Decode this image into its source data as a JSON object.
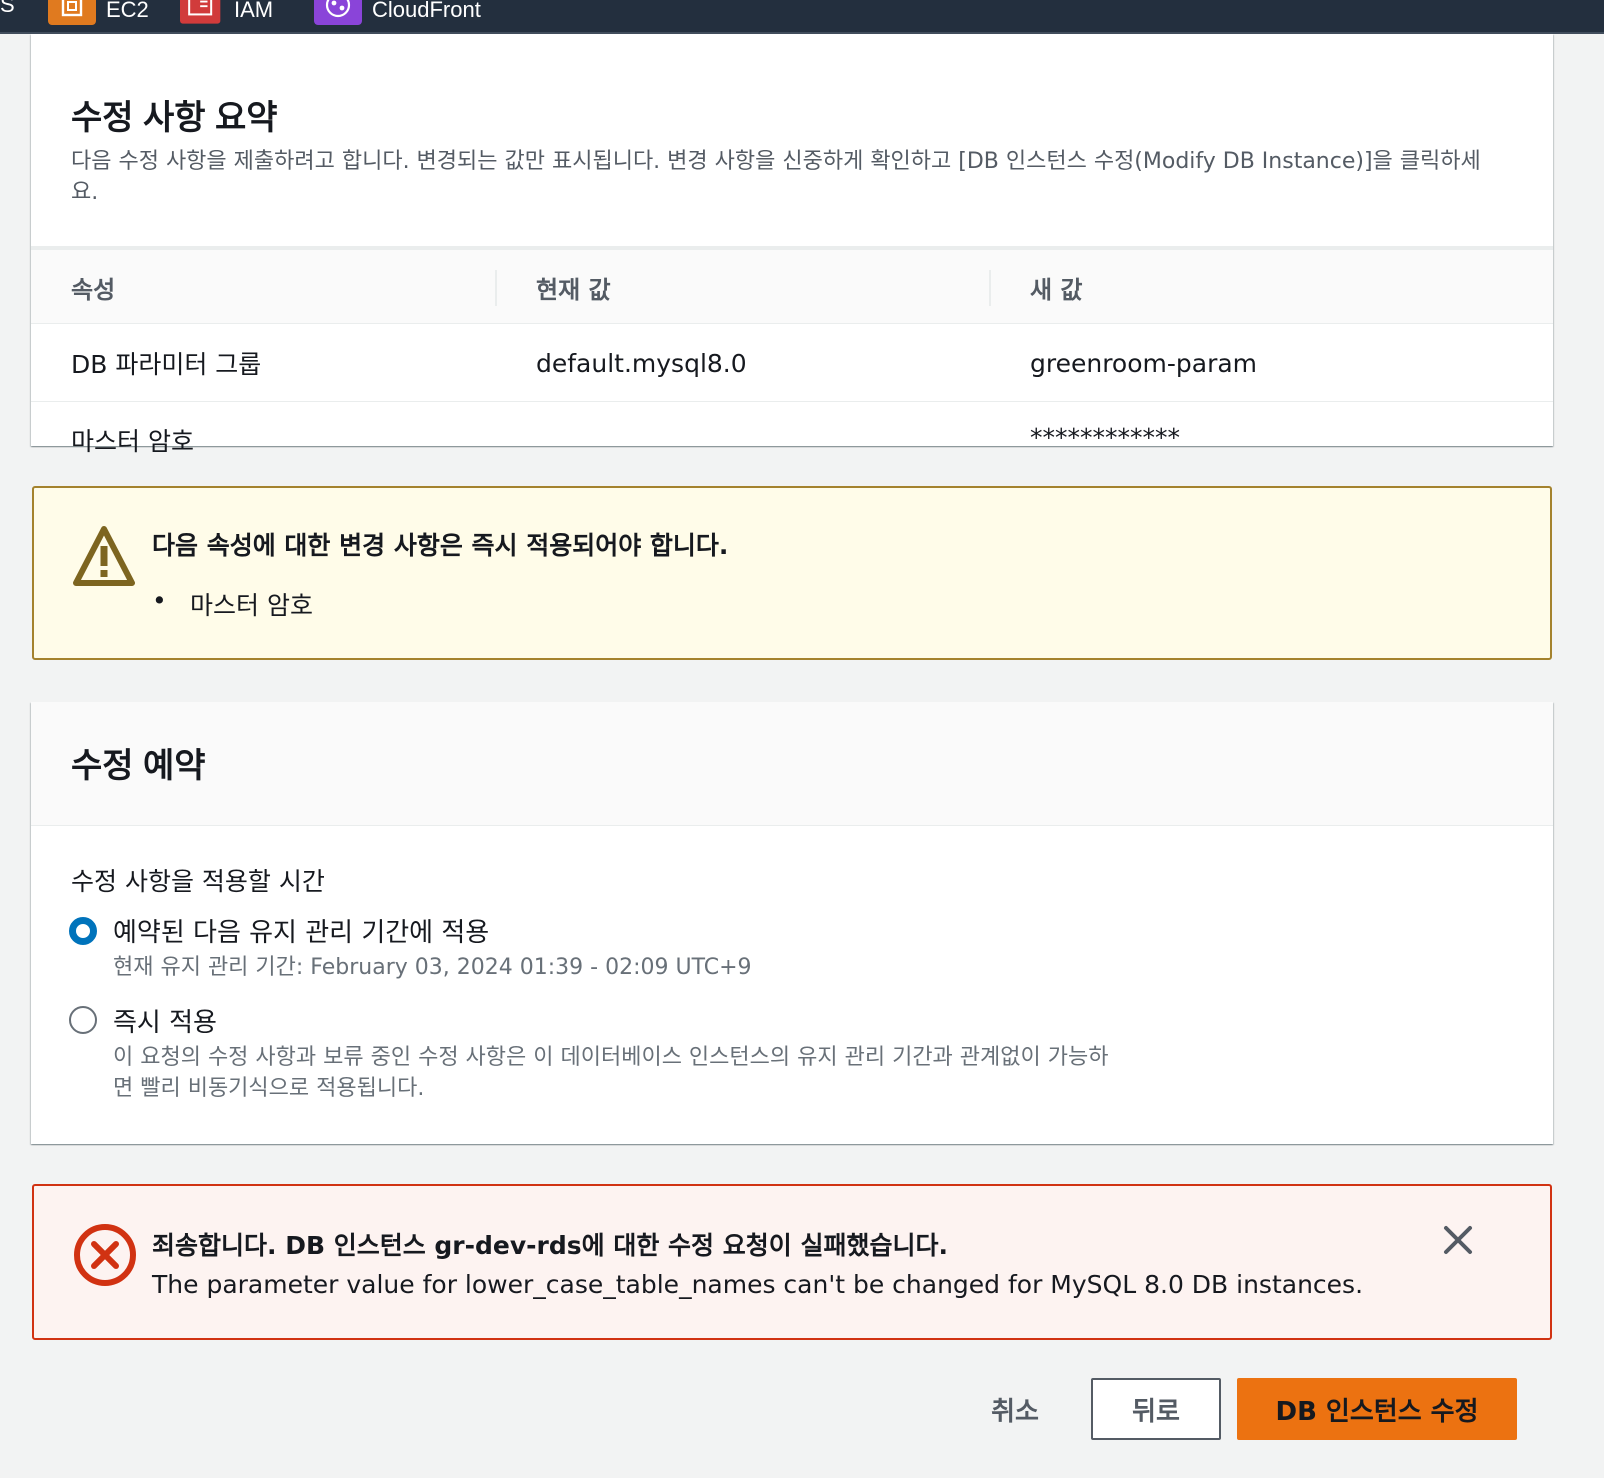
{
  "nav": {
    "partial_left": "S",
    "services": [
      {
        "label": "EC2",
        "icon": "ec2-icon",
        "color": "#e07a1f"
      },
      {
        "label": "IAM",
        "icon": "iam-icon",
        "color": "#d13b3b"
      },
      {
        "label": "CloudFront",
        "icon": "cloudfront-icon",
        "color": "#8a44d9"
      }
    ]
  },
  "summary": {
    "title": "수정 사항 요약",
    "description": "다음 수정 사항을 제출하려고 합니다. 변경되는 값만 표시됩니다. 변경 사항을 신중하게 확인하고 [DB 인스턴스 수정(Modify DB Instance)]을 클릭하세요.",
    "columns": [
      "속성",
      "현재 값",
      "새 값"
    ],
    "rows": [
      {
        "attribute": "DB 파라미터 그룹",
        "current": "default.mysql8.0",
        "new": "greenroom-param"
      },
      {
        "attribute": "마스터 암호",
        "current": "",
        "new": "************"
      }
    ]
  },
  "warning": {
    "icon": "warning-icon",
    "title": "다음 속성에 대한 변경 사항은 즉시 적용되어야 합니다.",
    "items": [
      "마스터 암호"
    ]
  },
  "schedule": {
    "title": "수정 예약",
    "field_label": "수정 사항을 적용할 시간",
    "options": [
      {
        "label": "예약된 다음 유지 관리 기간에 적용",
        "description": "현재 유지 관리 기간: February 03, 2024 01:39 - 02:09 UTC+9",
        "selected": true
      },
      {
        "label": "즉시 적용",
        "description": "이 요청의 수정 사항과 보류 중인 수정 사항은 이 데이터베이스 인스턴스의 유지 관리 기간과 관계없이 가능하면 빨리 비동기식으로 적용됩니다.",
        "selected": false
      }
    ]
  },
  "error": {
    "icon": "error-icon",
    "title": "죄송합니다. DB 인스턴스 gr-dev-rds에 대한 수정 요청이 실패했습니다.",
    "message": "The parameter value for lower_case_table_names can't be changed for MySQL 8.0 DB instances."
  },
  "footer": {
    "cancel_label": "취소",
    "back_label": "뒤로",
    "submit_label": "DB 인스턴스 수정"
  },
  "colors": {
    "accent": "#0073bb",
    "primary_button": "#ec7211",
    "warning_border": "#a4822d",
    "error_border": "#d13212"
  }
}
